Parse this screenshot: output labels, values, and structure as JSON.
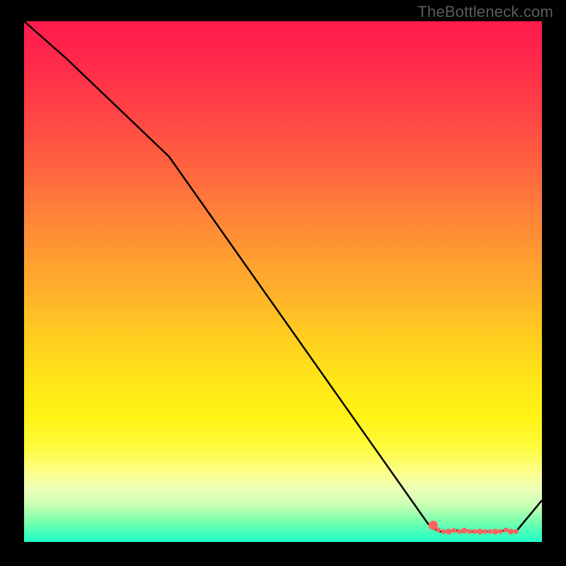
{
  "watermark": "TheBottleneck.com",
  "chart_data": {
    "type": "line",
    "title": "",
    "xlabel": "",
    "ylabel": "",
    "xlim": [
      0,
      100
    ],
    "ylim": [
      0,
      100
    ],
    "grid": false,
    "series": [
      {
        "name": "curve",
        "x": [
          0,
          8,
          28,
          78,
          80,
          82,
          83.5,
          84.5,
          85.5,
          86.5,
          88,
          90,
          92,
          93,
          95,
          100
        ],
        "values": [
          100,
          93,
          74,
          3.5,
          2,
          2,
          2.2,
          2,
          2.2,
          2,
          2,
          2,
          2,
          2.3,
          2,
          8
        ]
      }
    ],
    "markers": {
      "comment": "Red dotted markers near the trough",
      "x": [
        79,
        80,
        81,
        82,
        83,
        84,
        85,
        86,
        87,
        88,
        89,
        90,
        91,
        92,
        93,
        94,
        95
      ],
      "values": [
        3.2,
        2.3,
        2,
        2,
        2.2,
        2,
        2.2,
        2,
        2,
        2,
        2,
        2,
        2,
        2,
        2.3,
        2,
        2
      ]
    },
    "colors": {
      "curve": "#000000",
      "markers": "#ff6262",
      "background_top": "#ff1a4d",
      "background_bottom": "#1bffc8"
    }
  }
}
